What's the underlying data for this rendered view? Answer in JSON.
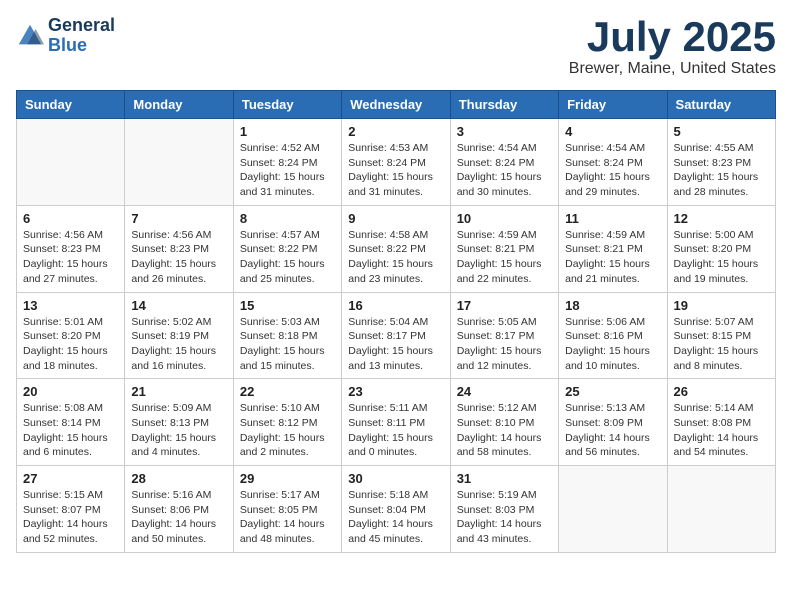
{
  "header": {
    "logo_line1": "General",
    "logo_line2": "Blue",
    "month": "July 2025",
    "location": "Brewer, Maine, United States"
  },
  "days_of_week": [
    "Sunday",
    "Monday",
    "Tuesday",
    "Wednesday",
    "Thursday",
    "Friday",
    "Saturday"
  ],
  "weeks": [
    [
      {
        "day": "",
        "info": ""
      },
      {
        "day": "",
        "info": ""
      },
      {
        "day": "1",
        "info": "Sunrise: 4:52 AM\nSunset: 8:24 PM\nDaylight: 15 hours\nand 31 minutes."
      },
      {
        "day": "2",
        "info": "Sunrise: 4:53 AM\nSunset: 8:24 PM\nDaylight: 15 hours\nand 31 minutes."
      },
      {
        "day": "3",
        "info": "Sunrise: 4:54 AM\nSunset: 8:24 PM\nDaylight: 15 hours\nand 30 minutes."
      },
      {
        "day": "4",
        "info": "Sunrise: 4:54 AM\nSunset: 8:24 PM\nDaylight: 15 hours\nand 29 minutes."
      },
      {
        "day": "5",
        "info": "Sunrise: 4:55 AM\nSunset: 8:23 PM\nDaylight: 15 hours\nand 28 minutes."
      }
    ],
    [
      {
        "day": "6",
        "info": "Sunrise: 4:56 AM\nSunset: 8:23 PM\nDaylight: 15 hours\nand 27 minutes."
      },
      {
        "day": "7",
        "info": "Sunrise: 4:56 AM\nSunset: 8:23 PM\nDaylight: 15 hours\nand 26 minutes."
      },
      {
        "day": "8",
        "info": "Sunrise: 4:57 AM\nSunset: 8:22 PM\nDaylight: 15 hours\nand 25 minutes."
      },
      {
        "day": "9",
        "info": "Sunrise: 4:58 AM\nSunset: 8:22 PM\nDaylight: 15 hours\nand 23 minutes."
      },
      {
        "day": "10",
        "info": "Sunrise: 4:59 AM\nSunset: 8:21 PM\nDaylight: 15 hours\nand 22 minutes."
      },
      {
        "day": "11",
        "info": "Sunrise: 4:59 AM\nSunset: 8:21 PM\nDaylight: 15 hours\nand 21 minutes."
      },
      {
        "day": "12",
        "info": "Sunrise: 5:00 AM\nSunset: 8:20 PM\nDaylight: 15 hours\nand 19 minutes."
      }
    ],
    [
      {
        "day": "13",
        "info": "Sunrise: 5:01 AM\nSunset: 8:20 PM\nDaylight: 15 hours\nand 18 minutes."
      },
      {
        "day": "14",
        "info": "Sunrise: 5:02 AM\nSunset: 8:19 PM\nDaylight: 15 hours\nand 16 minutes."
      },
      {
        "day": "15",
        "info": "Sunrise: 5:03 AM\nSunset: 8:18 PM\nDaylight: 15 hours\nand 15 minutes."
      },
      {
        "day": "16",
        "info": "Sunrise: 5:04 AM\nSunset: 8:17 PM\nDaylight: 15 hours\nand 13 minutes."
      },
      {
        "day": "17",
        "info": "Sunrise: 5:05 AM\nSunset: 8:17 PM\nDaylight: 15 hours\nand 12 minutes."
      },
      {
        "day": "18",
        "info": "Sunrise: 5:06 AM\nSunset: 8:16 PM\nDaylight: 15 hours\nand 10 minutes."
      },
      {
        "day": "19",
        "info": "Sunrise: 5:07 AM\nSunset: 8:15 PM\nDaylight: 15 hours\nand 8 minutes."
      }
    ],
    [
      {
        "day": "20",
        "info": "Sunrise: 5:08 AM\nSunset: 8:14 PM\nDaylight: 15 hours\nand 6 minutes."
      },
      {
        "day": "21",
        "info": "Sunrise: 5:09 AM\nSunset: 8:13 PM\nDaylight: 15 hours\nand 4 minutes."
      },
      {
        "day": "22",
        "info": "Sunrise: 5:10 AM\nSunset: 8:12 PM\nDaylight: 15 hours\nand 2 minutes."
      },
      {
        "day": "23",
        "info": "Sunrise: 5:11 AM\nSunset: 8:11 PM\nDaylight: 15 hours\nand 0 minutes."
      },
      {
        "day": "24",
        "info": "Sunrise: 5:12 AM\nSunset: 8:10 PM\nDaylight: 14 hours\nand 58 minutes."
      },
      {
        "day": "25",
        "info": "Sunrise: 5:13 AM\nSunset: 8:09 PM\nDaylight: 14 hours\nand 56 minutes."
      },
      {
        "day": "26",
        "info": "Sunrise: 5:14 AM\nSunset: 8:08 PM\nDaylight: 14 hours\nand 54 minutes."
      }
    ],
    [
      {
        "day": "27",
        "info": "Sunrise: 5:15 AM\nSunset: 8:07 PM\nDaylight: 14 hours\nand 52 minutes."
      },
      {
        "day": "28",
        "info": "Sunrise: 5:16 AM\nSunset: 8:06 PM\nDaylight: 14 hours\nand 50 minutes."
      },
      {
        "day": "29",
        "info": "Sunrise: 5:17 AM\nSunset: 8:05 PM\nDaylight: 14 hours\nand 48 minutes."
      },
      {
        "day": "30",
        "info": "Sunrise: 5:18 AM\nSunset: 8:04 PM\nDaylight: 14 hours\nand 45 minutes."
      },
      {
        "day": "31",
        "info": "Sunrise: 5:19 AM\nSunset: 8:03 PM\nDaylight: 14 hours\nand 43 minutes."
      },
      {
        "day": "",
        "info": ""
      },
      {
        "day": "",
        "info": ""
      }
    ]
  ]
}
